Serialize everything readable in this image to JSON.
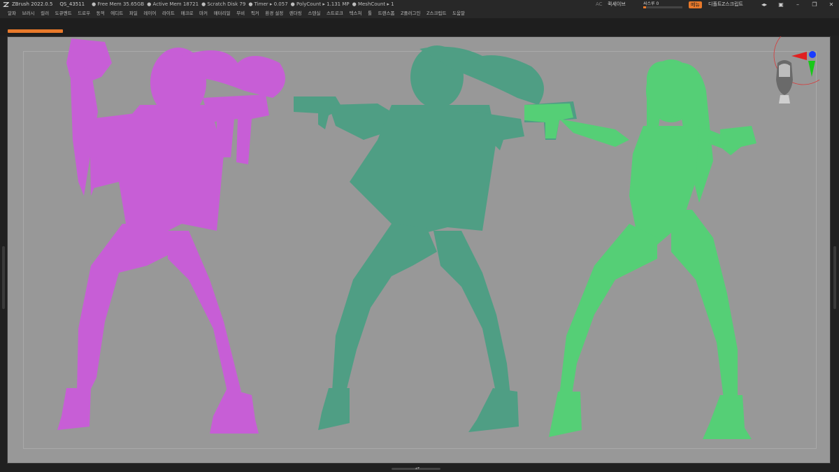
{
  "titlebar": {
    "app": "ZBrush 2022.0.5",
    "project": "QS_43511",
    "free_mem": "● Free Mem 35.65GB",
    "active_mem": "● Active Mem 18721",
    "scratch": "● Scratch Disk 79",
    "timer": "● Timer ▸ 0.057",
    "polycount": "● PolyCount ▸ 1.131 MP",
    "meshcount": "● MeshCount ▸ 1"
  },
  "right_controls": {
    "ac": "AC",
    "quicksave": "퀵세이브",
    "see_through_label": "씨스루  0",
    "see_through_value": 0.08,
    "menu": "메뉴",
    "default_script": "디폴트Z스크립트"
  },
  "menubar": {
    "items": [
      "알파",
      "브러시",
      "컬러",
      "도큐멘트",
      "드로우",
      "동적",
      "에디트",
      "파일",
      "레이어",
      "라이트",
      "매크로",
      "마커",
      "매터리얼",
      "무비",
      "픽커",
      "환경 설정",
      "렌더링",
      "스텐실",
      "스트로크",
      "텍스쳐",
      "툴",
      "트랜스폼",
      "Z플러그인",
      "Z스크립트",
      "도움말"
    ]
  },
  "colors": {
    "accent": "#e8792a",
    "figure_magenta": "#c75ed6",
    "figure_teal": "#4f9e84",
    "figure_green": "#55cf76",
    "canvas": "#989898"
  },
  "window_icons": [
    "undock-icon",
    "transparent-icon",
    "minimize-icon",
    "maximize-icon",
    "close-icon"
  ]
}
